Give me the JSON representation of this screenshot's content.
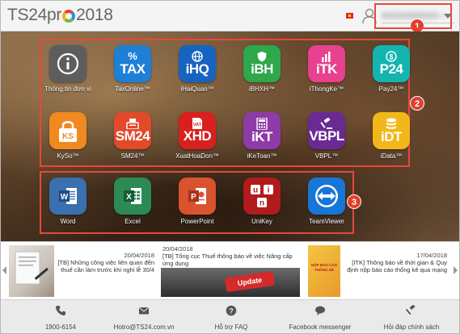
{
  "header": {
    "logo_left": "TS24pr",
    "logo_right": "2018",
    "account_value": "tsyn.ts24@ts24.com"
  },
  "badges": [
    "1",
    "2",
    "3"
  ],
  "apps_row1": [
    {
      "label": "Thông tin đơn vị",
      "text": "",
      "icon": "info-icon",
      "color": "#5d5d5d"
    },
    {
      "label": "TaxOnline™",
      "text": "TAX",
      "icon": "percent-icon",
      "color": "#1e7fd6"
    },
    {
      "label": "iHaiQuan™",
      "text": "iHQ",
      "icon": "globe-icon",
      "color": "#1664c0"
    },
    {
      "label": "iBHXH™",
      "text": "iBH",
      "icon": "shield-icon",
      "color": "#2ea84a"
    },
    {
      "label": "iThongKe™",
      "text": "iTK",
      "icon": "bar-chart-icon",
      "color": "#e8418f"
    },
    {
      "label": "Pay24™",
      "text": "P24",
      "icon": "dollar-icon",
      "color": "#14b5b0"
    }
  ],
  "apps_row2": [
    {
      "label": "KySo™",
      "text": "KS",
      "icon": "lock-icon",
      "color": "#f08a20"
    },
    {
      "label": "SM24™",
      "text": "SM24",
      "icon": "register-icon",
      "color": "#e24a2a"
    },
    {
      "label": "XuatHoaDon™",
      "text": "XHD",
      "icon": "vat-icon",
      "color": "#d8201e"
    },
    {
      "label": "iKeToan™",
      "text": "iKT",
      "icon": "calculator-icon",
      "color": "#8e3aa8"
    },
    {
      "label": "VBPL™",
      "text": "VBPL",
      "icon": "gavel-icon",
      "color": "#6a2a94"
    },
    {
      "label": "iData™",
      "text": "iDT",
      "icon": "database-icon",
      "color": "#f2b81a"
    }
  ],
  "apps_row3": [
    {
      "label": "Word",
      "text": "W",
      "icon": "word-icon",
      "color": "#2b5797"
    },
    {
      "label": "Excel",
      "text": "X",
      "icon": "excel-icon",
      "color": "#1e7145"
    },
    {
      "label": "PowerPoint",
      "text": "P",
      "icon": "powerpoint-icon",
      "color": "#d24726"
    },
    {
      "label": "UniKey",
      "text": "uin",
      "icon": "unikey-icon",
      "color": "#b01c1c"
    },
    {
      "label": "TeamViewer",
      "text": "",
      "icon": "teamviewer-icon",
      "color": "#1776d6"
    }
  ],
  "news": [
    {
      "date": "20/04/2018",
      "title": "[TB] Những công việc liên quan đến thuế cần làm trước khi nghỉ lễ 30/4"
    },
    {
      "date": "20/04/2018",
      "title": "[TB] Tổng cục Thuế thông báo về việc Nâng cấp ứng dụng",
      "thumb_text": "Update"
    },
    {
      "date": "17/04/2018",
      "title": "[ITK] Thông báo về thời gian & Quy định nộp báo cáo thống kê qua mạng",
      "thumb_text": "NỘP BÁO CÁO THỐNG KÊ"
    }
  ],
  "footer": [
    {
      "label": "1900-6154",
      "icon": "phone-icon"
    },
    {
      "label": "Hotro@TS24.com.vn",
      "icon": "envelope-icon"
    },
    {
      "label": "Hỗ trợ FAQ",
      "icon": "question-icon"
    },
    {
      "label": "Facebook messenger",
      "icon": "chat-icon"
    },
    {
      "label": "Hỏi đáp chính sách",
      "icon": "gavel-icon"
    }
  ]
}
